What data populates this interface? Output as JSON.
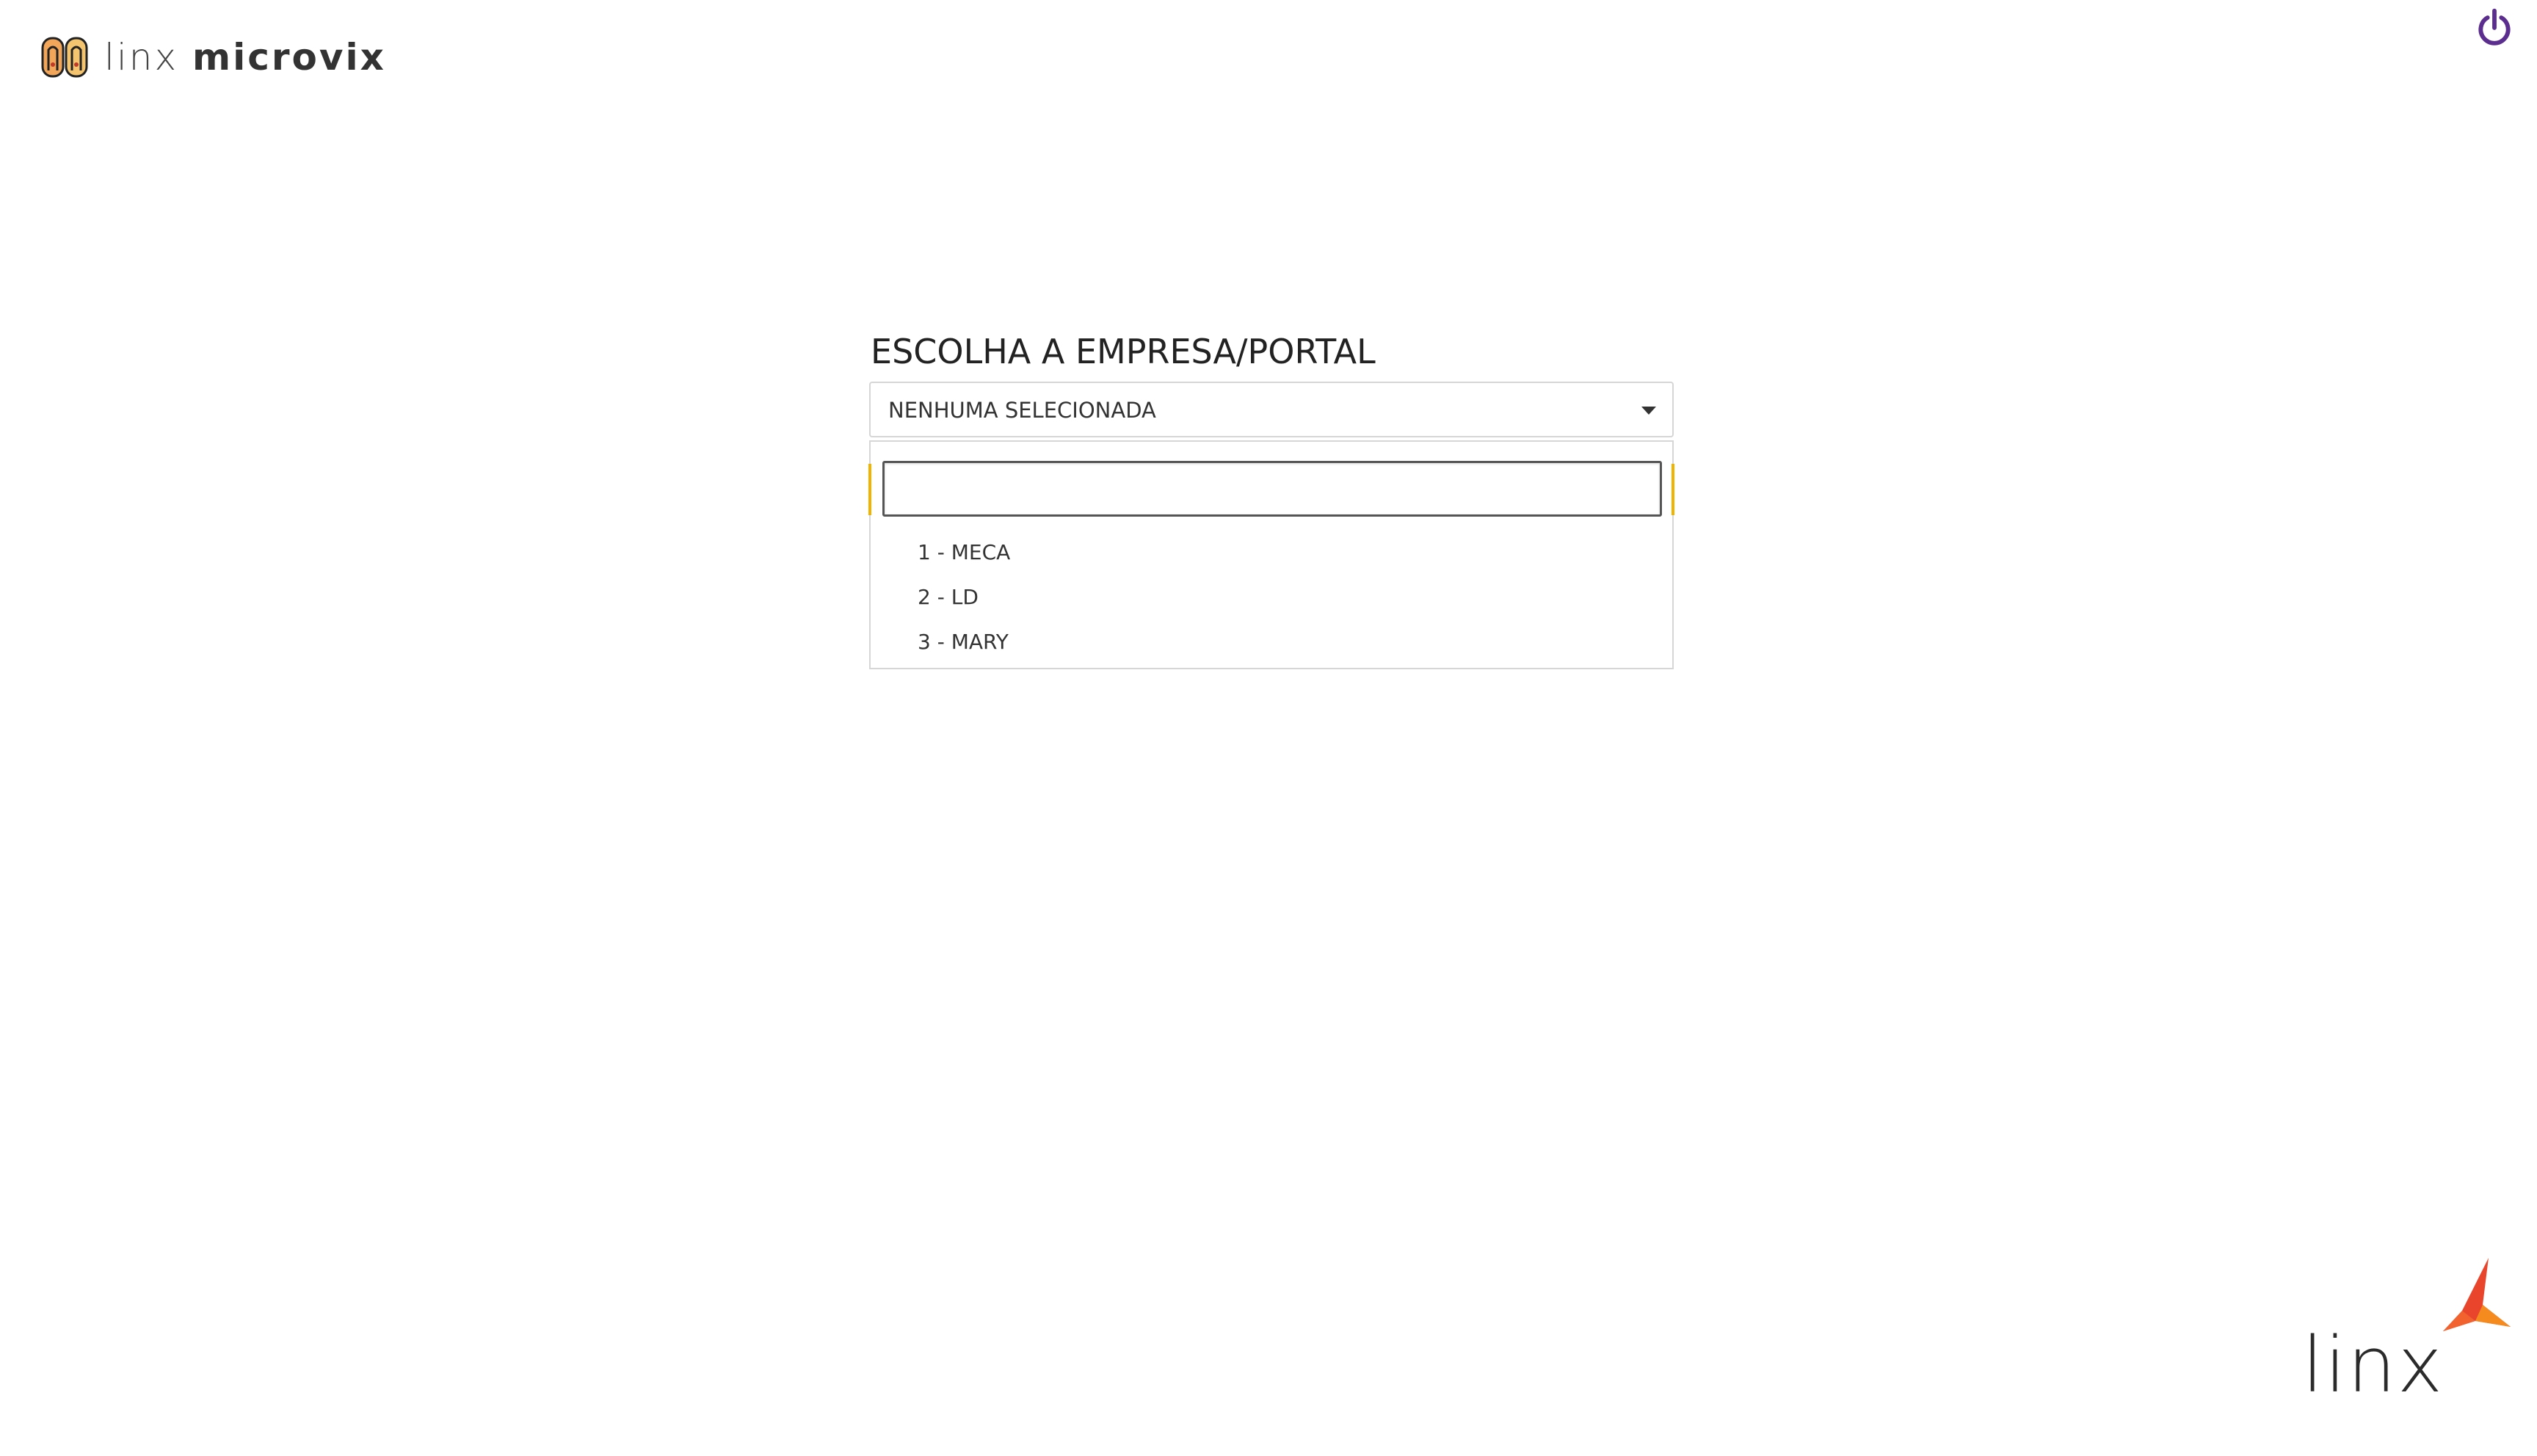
{
  "header": {
    "logo_word_light": "linx",
    "logo_word_bold": "microvix",
    "logo_icon": "microvix-logo-icon",
    "power_icon": "power-icon",
    "power_color": "#5b2d8e"
  },
  "chooser": {
    "title": "ESCOLHA A EMPRESA/PORTAL",
    "selected_value": "NENHUMA SELECIONADA",
    "search_value": "",
    "options": [
      {
        "label": "1 - MECA"
      },
      {
        "label": "2 - LD"
      },
      {
        "label": "3 - MARY"
      }
    ],
    "accent_color": "#f0b400"
  },
  "footer": {
    "brand_text": "linx",
    "brand_icon": "linx-star-icon",
    "brand_colors": [
      "#e8452c",
      "#f58a1f"
    ]
  }
}
